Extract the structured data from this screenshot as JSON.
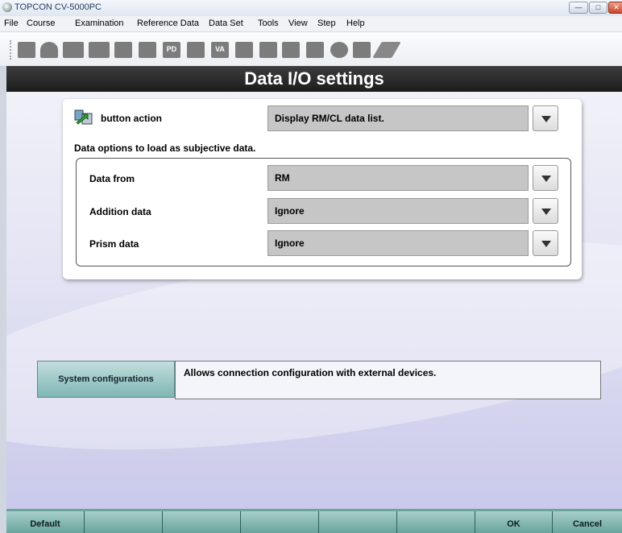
{
  "window": {
    "title": "TOPCON CV-5000PC"
  },
  "menu": [
    "File",
    "Course",
    "Examination",
    "Reference Data",
    "Data Set",
    "Tools",
    "View",
    "Step",
    "Help"
  ],
  "toolbar": {
    "pd_label": "PD",
    "va_label": "VA"
  },
  "page": {
    "title": "Data I/O settings"
  },
  "button_action": {
    "label": "button action",
    "value": "Display RM/CL data list."
  },
  "subjective": {
    "heading": "Data options to load as subjective data.",
    "rows": [
      {
        "label": "Data from",
        "value": "RM"
      },
      {
        "label": "Addition data",
        "value": "Ignore"
      },
      {
        "label": "Prism data",
        "value": "Ignore"
      }
    ]
  },
  "system": {
    "button_label": "System configurations",
    "description": "Allows connection configuration with external devices."
  },
  "bottom": {
    "default_label": "Default",
    "ok_label": "OK",
    "cancel_label": "Cancel"
  },
  "icons": [
    "app-icon",
    "minimize-icon",
    "maximize-icon",
    "close-icon",
    "chevron-down-icon",
    "data-transfer-icon"
  ]
}
